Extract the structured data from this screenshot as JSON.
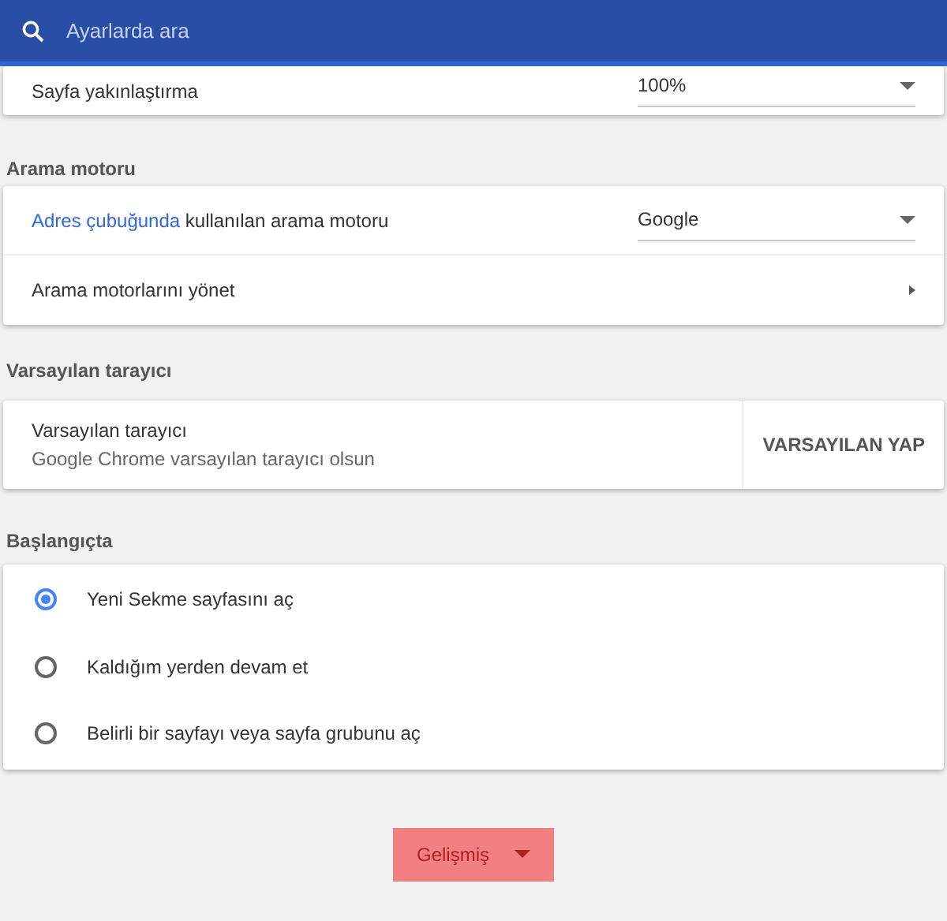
{
  "search": {
    "placeholder": "Ayarlarda ara"
  },
  "zoom_card": {
    "label": "Sayfa yakınlaştırma",
    "value": "100%"
  },
  "search_engine": {
    "heading": "Arama motoru",
    "engine_row": {
      "link": "Adres çubuğunda",
      "label": "kullanılan arama motoru",
      "value": "Google"
    },
    "manage_row": {
      "label": "Arama motorlarını yönet"
    }
  },
  "default_browser": {
    "heading": "Varsayılan tarayıcı",
    "title": "Varsayılan tarayıcı",
    "subtitle": "Google Chrome varsayılan tarayıcı olsun",
    "button": "VARSAYILAN YAP"
  },
  "startup": {
    "heading": "Başlangıçta",
    "options": [
      {
        "label": "Yeni Sekme sayfasını aç",
        "selected": true
      },
      {
        "label": "Kaldığım yerden devam et",
        "selected": false
      },
      {
        "label": "Belirli bir sayfayı veya sayfa grubunu aç",
        "selected": false
      }
    ]
  },
  "advanced_button": {
    "label": "Gelişmiş"
  }
}
